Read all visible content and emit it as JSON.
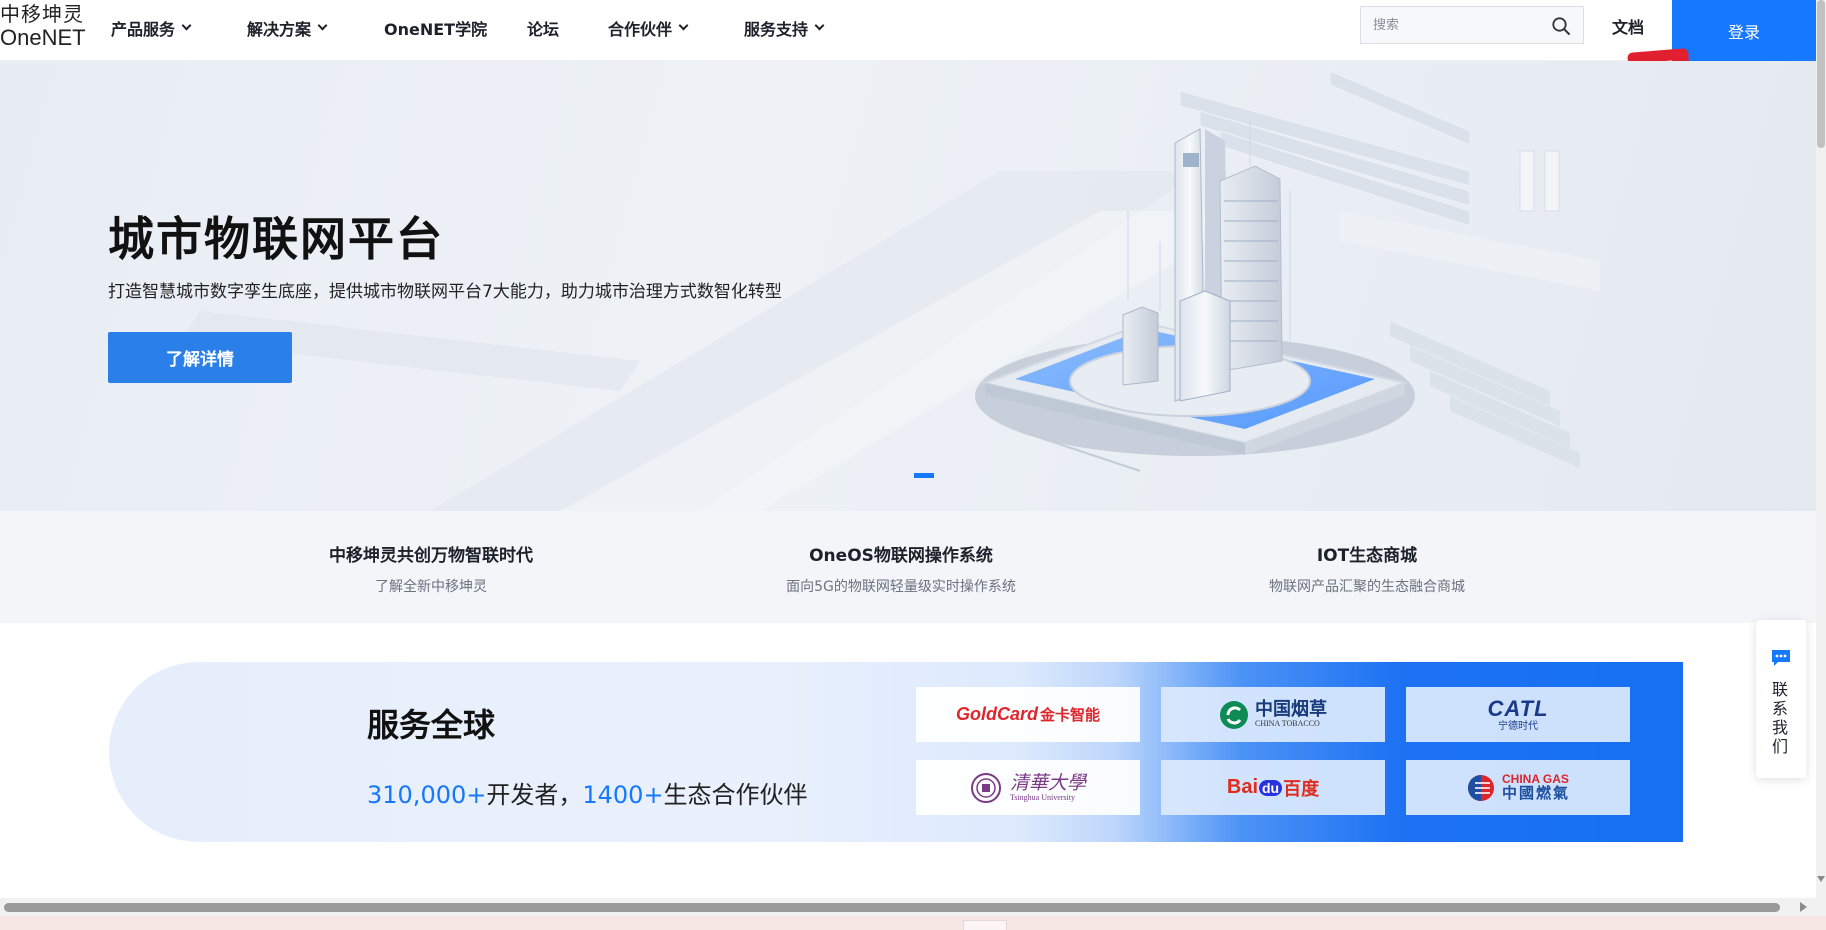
{
  "logo": {
    "cn": "中移坤灵",
    "en": "OneNET"
  },
  "nav": {
    "items": [
      {
        "label": "产品服务",
        "dropdown": true
      },
      {
        "label": "解决方案",
        "dropdown": true
      },
      {
        "label": "OneNET学院",
        "dropdown": false
      },
      {
        "label": "论坛",
        "dropdown": false
      },
      {
        "label": "合作伙伴",
        "dropdown": true
      },
      {
        "label": "服务支持",
        "dropdown": true
      }
    ],
    "search_placeholder": "搜索",
    "doc_label": "文档",
    "login_label": "登录"
  },
  "hero": {
    "title": "城市物联网平台",
    "subtitle": "打造智慧城市数字孪生底座，提供城市物联网平台7大能力，助力城市治理方式数智化转型",
    "button_label": "了解详情"
  },
  "features": [
    {
      "title": "中移坤灵共创万物智联时代",
      "desc": "了解全新中移坤灵"
    },
    {
      "title": "OneOS物联网操作系统",
      "desc": "面向5G的物联网轻量级实时操作系统"
    },
    {
      "title": "IOT生态商城",
      "desc": "物联网产品汇聚的生态融合商城"
    }
  ],
  "global": {
    "title": "服务全球",
    "developers_num": "310,000+",
    "developers_label": "开发者，",
    "partners_num": "1400+",
    "partners_label": "生态合作伙伴"
  },
  "partners": {
    "goldcard": {
      "en": "GoldCard",
      "cn": "金卡智能"
    },
    "tobacco": {
      "cn": "中国烟草",
      "en": "CHINA TOBACCO"
    },
    "catl": {
      "en": "CATL",
      "cn": "宁德时代"
    },
    "tsinghua": {
      "cn": "清華大學",
      "en": "Tsinghua University"
    },
    "baidu": {
      "en1": "Bai",
      "en2": "du",
      "cn": "百度"
    },
    "chinagas": {
      "en": "CHINA GAS",
      "cn": "中國燃氣"
    }
  },
  "contact": {
    "label": "联系我们"
  },
  "colors": {
    "primary": "#1677ff",
    "hero_button": "#2a7fe8",
    "arrow": "#e0202f"
  },
  "icons": [
    "search-icon",
    "chevron-down-icon",
    "chat-icon",
    "arrow-annotation"
  ]
}
